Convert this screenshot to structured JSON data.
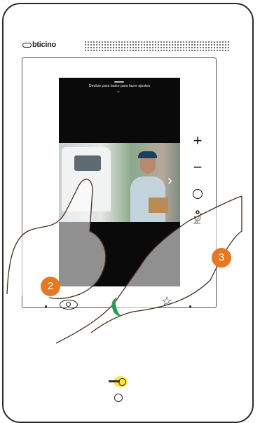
{
  "brand": {
    "logo_text": "bticino"
  },
  "video": {
    "swipe_hint": "Deslize para baixo para fazer ajustes",
    "chevron": "⌄",
    "next_arrow": "›"
  },
  "side_buttons": {
    "plus": "+",
    "minus": "−",
    "mute": "🎙"
  },
  "callouts": {
    "step2": "2",
    "step3": "3"
  },
  "bottom_buttons": {
    "star": "☆"
  },
  "colors": {
    "accent": "#e87722",
    "answer": "#2e9a58",
    "key_light": "#ffe34a"
  }
}
